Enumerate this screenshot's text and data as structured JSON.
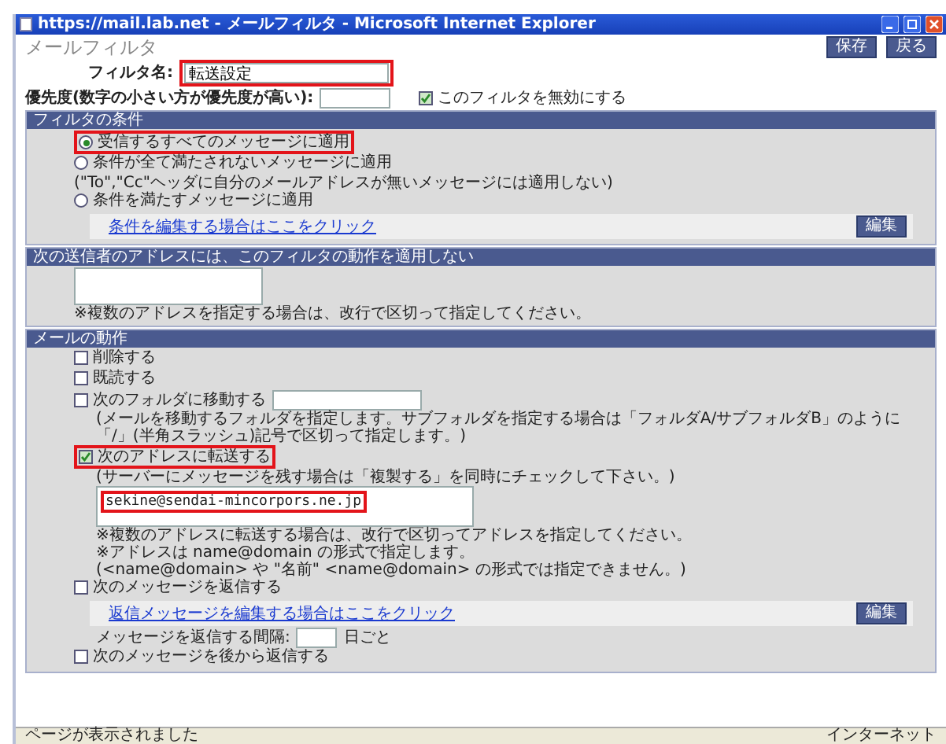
{
  "window": {
    "title": "https://mail.lab.net - メールフィルタ - Microsoft Internet Explorer"
  },
  "window_controls": [
    {
      "kind": "minimize"
    },
    {
      "kind": "maximize"
    },
    {
      "kind": "close"
    }
  ],
  "page": {
    "title": "メールフィルタ",
    "buttons": [
      "保存",
      "戻る"
    ]
  },
  "filter_name": {
    "label": "フィルタ名:",
    "value": "転送設定",
    "highlighted": true
  },
  "priority": {
    "label": "優先度(数字の小さい方が優先度が高い):"
  },
  "disable": {
    "label": "このフィルタを無効にする",
    "checked": true
  },
  "conditions": {
    "header": "フィルタの条件",
    "options": [
      {
        "label": "受信するすべてのメッセージに適用",
        "selected": true,
        "highlighted": true
      },
      {
        "label": "条件が全て満たされないメッセージに適用",
        "selected": false,
        "note": "(\"To\",\"Cc\"ヘッダに自分のメールアドレスが無いメッセージには適用しない)"
      },
      {
        "label": "条件を満たすメッセージに適用",
        "selected": false
      }
    ],
    "link": "条件を編集する場合はここをクリック",
    "button": "編集"
  },
  "exclusions": {
    "header": "次の送信者のアドレスには、このフィルタの動作を適用しない",
    "note": "※複数のアドレスを指定する場合は、改行で区切って指定してください。"
  },
  "actions": {
    "header": "メールの動作",
    "items": [
      {
        "kind": "check",
        "label": "削除する",
        "checked": false
      },
      {
        "kind": "check",
        "label": "既読する",
        "checked": false
      },
      {
        "kind": "folder",
        "label": "次のフォルダに移動する",
        "checked": false,
        "note": "(メールを移動するフォルダを指定します。サブフォルダを指定する場合は「フォルダA/サブフォルダB」のように「/」(半角スラッシュ)記号で区切って指定します。)"
      },
      {
        "kind": "forward",
        "label": "次のアドレスに転送する",
        "checked": true,
        "highlighted": true,
        "note": "(サーバーにメッセージを残す場合は「複製する」を同時にチェックして下さい。)",
        "value": "sekine@sendai-mincorpors.ne.jp",
        "value_highlighted": true,
        "notes": [
          "※複数のアドレスに転送する場合は、改行で区切ってアドレスを指定してください。",
          "※アドレスは name@domain の形式で指定します。",
          "(<name@domain> や \"名前\" <name@domain> の形式では指定できません。)"
        ]
      },
      {
        "kind": "reply",
        "label": "次のメッセージを返信する",
        "checked": false,
        "link": "返信メッセージを編集する場合はここをクリック",
        "button": "編集",
        "interval_label": "メッセージを返信する間隔:",
        "interval_unit": "日ごと"
      },
      {
        "kind": "check",
        "label": "次のメッセージを後から返信する",
        "checked": false
      }
    ]
  },
  "status_bar": {
    "text": "ページが表示されました",
    "zone": "インターネット"
  }
}
